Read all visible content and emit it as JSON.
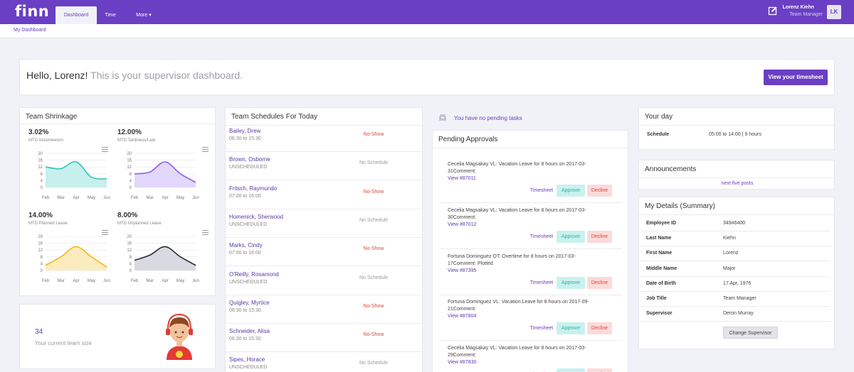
{
  "header": {
    "logo": "finn",
    "tabs": [
      {
        "label": "Dashboard"
      },
      {
        "label": "Time"
      },
      {
        "label": "More"
      }
    ],
    "user_name": "Lorenz Kiehn",
    "user_role": "Team Manager",
    "avatar_initials": "LK",
    "accent": "#6a3fc4"
  },
  "breadcrumb": "My Dashboard",
  "welcome": {
    "greeting": "Hello, Lorenz!",
    "subtitle": "This is your supervisor dashboard.",
    "button": "View your timesheet"
  },
  "shrinkage": {
    "title": "Team Shrinkage",
    "charts": [
      {
        "value": "3.02%",
        "label": "MTD Absenteeism",
        "color": "#2cc6bd",
        "fill": "#c7efec",
        "chart_data": {
          "type": "area",
          "x": [
            "Feb",
            "Mar",
            "Apr",
            "May",
            "Jun"
          ],
          "y": [
            12,
            11,
            15,
            6,
            5
          ],
          "yticks": [
            "20",
            "16",
            "12",
            "8",
            "4",
            "0"
          ],
          "ylim": [
            0,
            20
          ]
        }
      },
      {
        "value": "12.00%",
        "label": "MTD Tardiness/Late",
        "color": "#8b5cf6",
        "fill": "#e3d7fb",
        "chart_data": {
          "type": "area",
          "x": [
            "Feb",
            "Mar",
            "Apr",
            "May",
            "Jun"
          ],
          "y": [
            8,
            9,
            15,
            8,
            3
          ],
          "yticks": [
            "20",
            "16",
            "12",
            "8",
            "4",
            "0"
          ],
          "ylim": [
            0,
            20
          ]
        }
      },
      {
        "value": "14.00%",
        "label": "MTD Planned Leave",
        "color": "#f5b814",
        "fill": "#fbecc0",
        "chart_data": {
          "type": "area",
          "x": [
            "Feb",
            "Mar",
            "Apr",
            "May",
            "Jun"
          ],
          "y": [
            3,
            8,
            14,
            8,
            2
          ],
          "yticks": [
            "20",
            "16",
            "12",
            "8",
            "4",
            "0"
          ],
          "ylim": [
            0,
            20
          ]
        }
      },
      {
        "value": "8.00%",
        "label": "MTD Unplanned Leave",
        "color": "#2a2a35",
        "fill": "#d9d9e2",
        "chart_data": {
          "type": "area",
          "x": [
            "Feb",
            "Mar",
            "Apr",
            "May",
            "Jun"
          ],
          "y": [
            6,
            9,
            14,
            8,
            3
          ],
          "yticks": [
            "20",
            "16",
            "12",
            "8",
            "4",
            "0"
          ],
          "ylim": [
            0,
            20
          ]
        }
      }
    ]
  },
  "team_size": {
    "value": "34",
    "label": "Your current team size"
  },
  "schedules": {
    "title": "Team Schedules For Today",
    "rows": [
      {
        "name": "Bailey, Drew",
        "time": "06:30 to 15:30",
        "status": "No-Show"
      },
      {
        "name": "Brown, Osborne",
        "time": "UNSCHEDULED",
        "status": "No Schedule"
      },
      {
        "name": "Fritsch, Raymundo",
        "time": "07:00 to 16:00",
        "status": "No-Show"
      },
      {
        "name": "Homenick, Sherwood",
        "time": "UNSCHEDULED",
        "status": "No Schedule"
      },
      {
        "name": "Marks, Cindy",
        "time": "07:00 to 16:00",
        "status": "No-Show"
      },
      {
        "name": "O'Reilly, Rosamond",
        "time": "UNSCHEDULED",
        "status": "No Schedule"
      },
      {
        "name": "Quigley, Myrtice",
        "time": "06:30 to 15:30",
        "status": "No-Show"
      },
      {
        "name": "Schneider, Alisa",
        "time": "06:30 to 15:30",
        "status": "No-Show"
      },
      {
        "name": "Sipes, Horace",
        "time": "UNSCHEDULED",
        "status": "No Schedule"
      }
    ]
  },
  "tasks": {
    "message": "You have no pending tasks"
  },
  "approvals": {
    "title": "Pending Approvals",
    "timesheet_label": "Timesheet",
    "approve_label": "Approve",
    "decline_label": "Decline",
    "items": [
      {
        "l1": "Cecelia Magsakay VL: Vacation Leave for 8 hours on 2017-03-",
        "l2": "31Comment:",
        "link": "View #87011"
      },
      {
        "l1": "Cecelia Magsakay VL: Vacation Leave for 8 hours on 2017-03-",
        "l2": "30Comment:",
        "link": "View #87012"
      },
      {
        "l1": "Fortuna Dominguez OT: Overtime for 8 hours on 2017-03-",
        "l2": "17Comment: Plotted",
        "link": "View #87395"
      },
      {
        "l1": "Fortuna Dominguez VL: Vacation Leave for 8 hours on 2017-09-",
        "l2": "21Comment:",
        "link": "View #87804"
      },
      {
        "l1": "Cecelia Magsakay VL: Vacation Leave for 8 hours on 2017-03-",
        "l2": "29Comment:",
        "link": "View #87830"
      }
    ]
  },
  "your_day": {
    "title": "Your day",
    "label": "Schedule",
    "value": "05:00 to 14:00 | 9 hours"
  },
  "announcements": {
    "title": "Announcements",
    "link": "next five posts"
  },
  "details": {
    "title": "My Details (Summary)",
    "rows": [
      {
        "label": "Employee ID",
        "value": "34946400"
      },
      {
        "label": "Last Name",
        "value": "Kiehn"
      },
      {
        "label": "First Name",
        "value": "Lorenz"
      },
      {
        "label": "Middle Name",
        "value": "Major"
      },
      {
        "label": "Date of Birth",
        "value": "17 Apr, 1976"
      },
      {
        "label": "Job Title",
        "value": "Team Manager"
      },
      {
        "label": "Supervisor",
        "value": "Deron Murray"
      }
    ],
    "button": "Change Supervisor"
  }
}
